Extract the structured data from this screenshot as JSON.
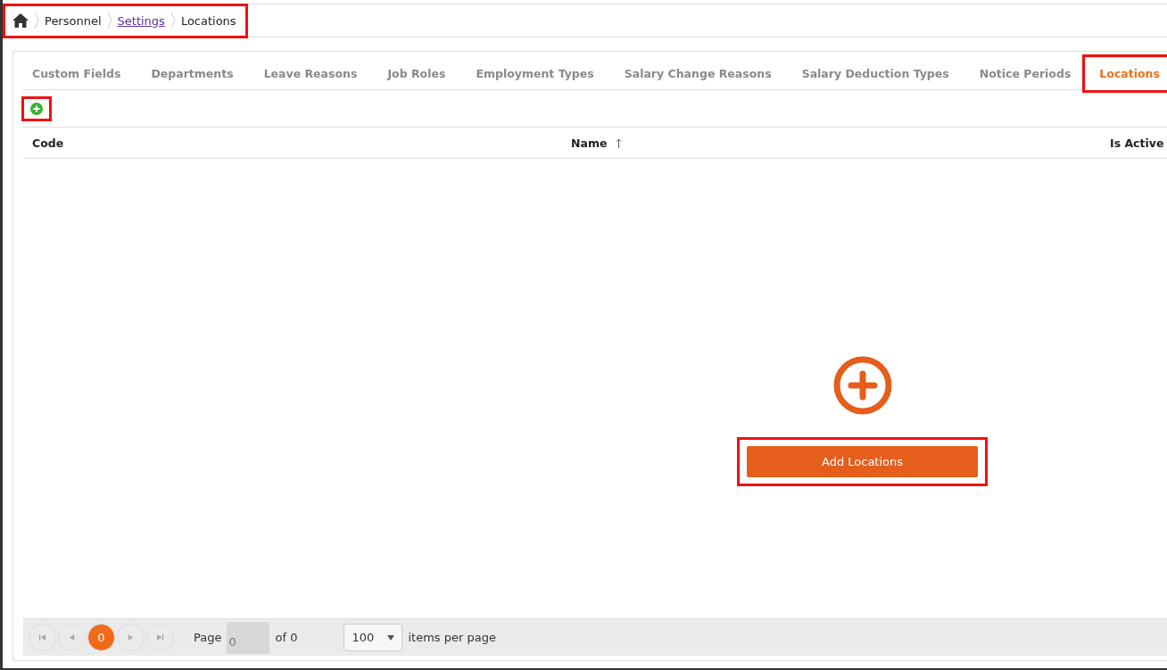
{
  "breadcrumb": {
    "highlighted": true,
    "items": [
      {
        "label": "Personnel",
        "kind": "text"
      },
      {
        "label": "Settings",
        "kind": "link"
      },
      {
        "label": "Locations",
        "kind": "text"
      }
    ]
  },
  "tabs": [
    {
      "label": "Custom Fields",
      "selected": false,
      "highlighted": false
    },
    {
      "label": "Departments",
      "selected": false,
      "highlighted": false
    },
    {
      "label": "Leave Reasons",
      "selected": false,
      "highlighted": false
    },
    {
      "label": "Job Roles",
      "selected": false,
      "highlighted": false
    },
    {
      "label": "Employment Types",
      "selected": false,
      "highlighted": false
    },
    {
      "label": "Salary Change Reasons",
      "selected": false,
      "highlighted": false
    },
    {
      "label": "Salary Deduction Types",
      "selected": false,
      "highlighted": false
    },
    {
      "label": "Notice Periods",
      "selected": false,
      "highlighted": false
    },
    {
      "label": "Locations",
      "selected": true,
      "highlighted": true
    }
  ],
  "toolbar": {
    "add_button_highlighted": true
  },
  "table": {
    "columns": [
      {
        "label": "Code",
        "sorted": false
      },
      {
        "label": "Name",
        "sorted": true
      },
      {
        "label": "Is Active"
      }
    ]
  },
  "empty_state": {
    "button": "Add Locations",
    "highlighted": true
  },
  "pager": {
    "current_page": "0",
    "page_label": "Page",
    "page_value": "0",
    "of_label": "of 0",
    "page_size": "100",
    "page_size_label": "items per page"
  }
}
